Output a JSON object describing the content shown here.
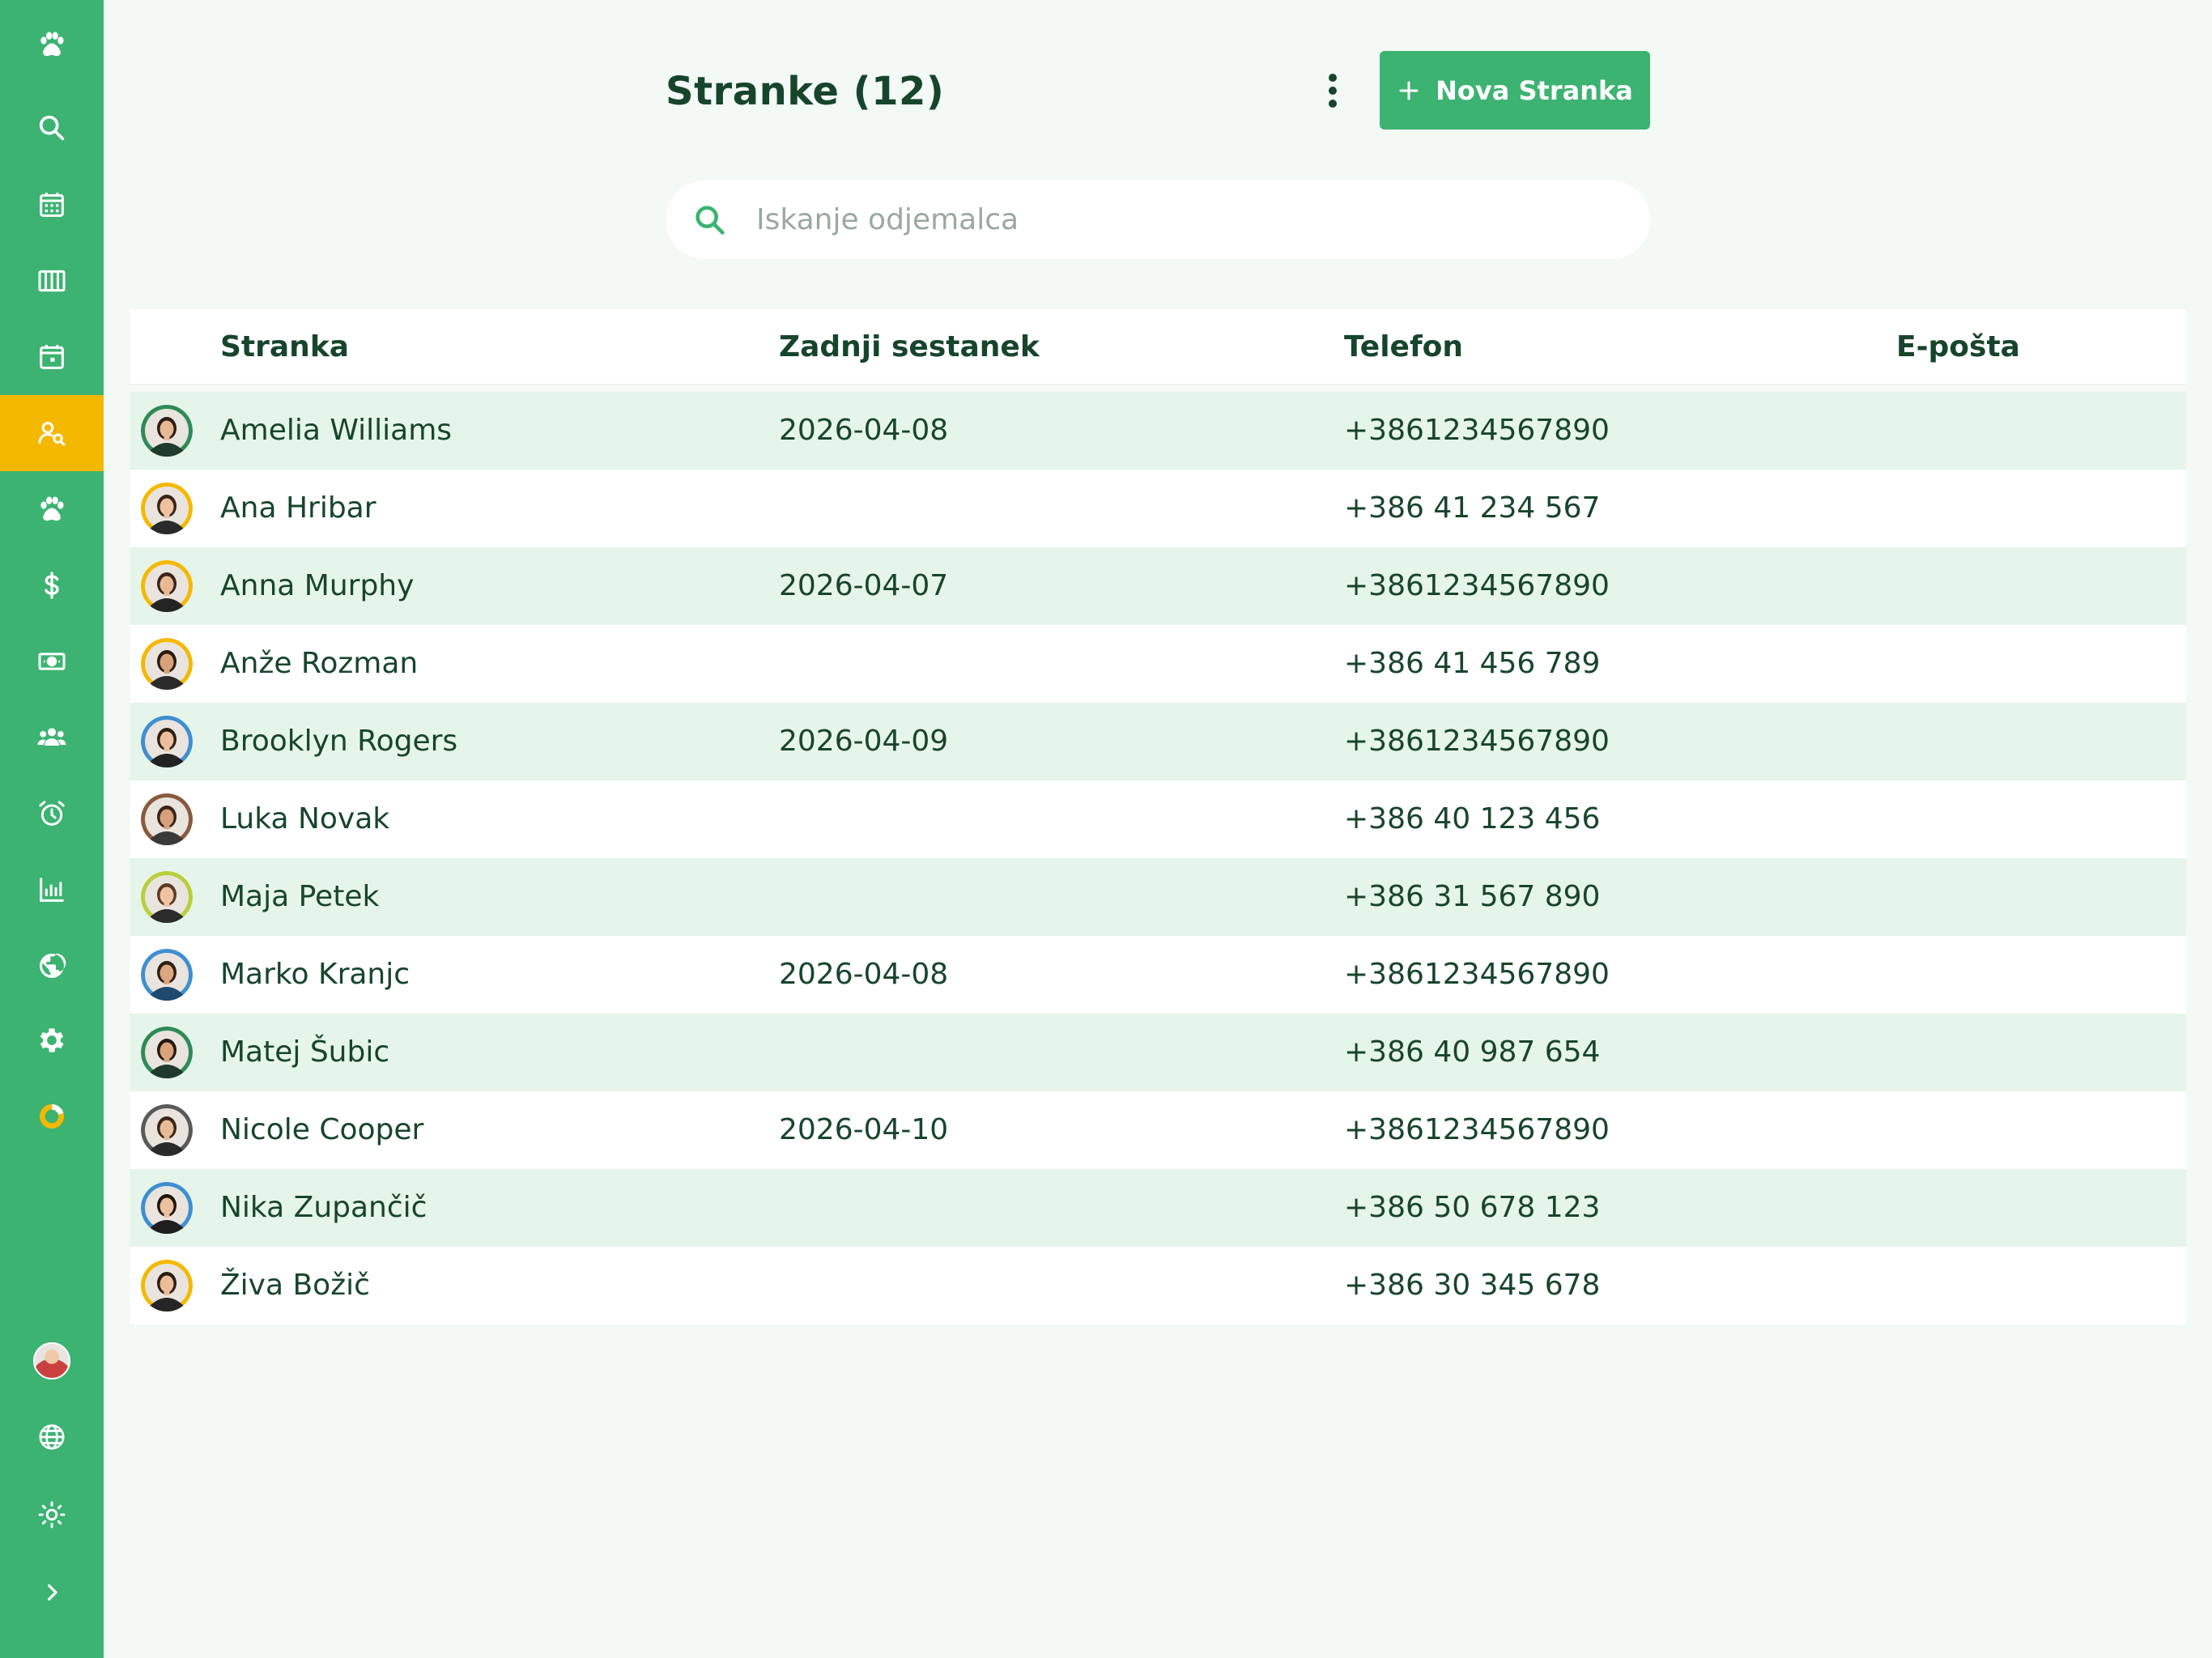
{
  "sidebar": {
    "items": [
      {
        "icon": "paw-icon",
        "name": "nav-home"
      },
      {
        "icon": "search-icon",
        "name": "nav-search"
      },
      {
        "icon": "calendar-icon",
        "name": "nav-calendar"
      },
      {
        "icon": "columns-icon",
        "name": "nav-board"
      },
      {
        "icon": "calendar-day-icon",
        "name": "nav-schedule"
      },
      {
        "icon": "client-search-icon",
        "name": "nav-clients",
        "active": true
      },
      {
        "icon": "paw-icon",
        "name": "nav-pets"
      },
      {
        "icon": "dollar-icon",
        "name": "nav-payments"
      },
      {
        "icon": "banknote-icon",
        "name": "nav-cash"
      },
      {
        "icon": "users-icon",
        "name": "nav-team"
      },
      {
        "icon": "alarm-icon",
        "name": "nav-reminders"
      },
      {
        "icon": "chart-icon",
        "name": "nav-reports"
      },
      {
        "icon": "globe-icon",
        "name": "nav-web"
      },
      {
        "icon": "gear-icon",
        "name": "nav-settings"
      },
      {
        "icon": "donut-icon",
        "name": "nav-usage"
      }
    ],
    "bottom": [
      {
        "icon": "user-avatar",
        "name": "nav-profile"
      },
      {
        "icon": "language-icon",
        "name": "nav-language"
      },
      {
        "icon": "sun-icon",
        "name": "nav-theme"
      },
      {
        "icon": "chevron-right-icon",
        "name": "nav-expand"
      }
    ],
    "colors": {
      "background": "#3cb371",
      "active": "#f5b800"
    }
  },
  "header": {
    "title": "Stranke (12)",
    "new_button_label": "Nova Stranka"
  },
  "search": {
    "placeholder": "Iskanje odjemalca",
    "value": ""
  },
  "table": {
    "columns": [
      "Stranka",
      "Zadnji sestanek",
      "Telefon",
      "E-pošta"
    ],
    "rows": [
      {
        "name": "Amelia Williams",
        "last_meeting": "2026-04-08",
        "phone": "+3861234567890",
        "email": "",
        "ring": "#2e8b57",
        "skin": "#e8b894",
        "hair": "#2b1d14",
        "shirt": "#1f3b2c"
      },
      {
        "name": "Ana Hribar",
        "last_meeting": "",
        "phone": "+386 41 234 567",
        "email": "",
        "ring": "#f5b800",
        "skin": "#eec1a0",
        "hair": "#3a2416",
        "shirt": "#2a2a2a"
      },
      {
        "name": "Anna Murphy",
        "last_meeting": "2026-04-07",
        "phone": "+3861234567890",
        "email": "",
        "ring": "#f5b800",
        "skin": "#e9b996",
        "hair": "#3b2518",
        "shirt": "#242424"
      },
      {
        "name": "Anže Rozman",
        "last_meeting": "",
        "phone": "+386 41 456 789",
        "email": "",
        "ring": "#f5b800",
        "skin": "#d9a27a",
        "hair": "#2a1a10",
        "shirt": "#2b2b2b"
      },
      {
        "name": "Brooklyn Rogers",
        "last_meeting": "2026-04-09",
        "phone": "+3861234567890",
        "email": "",
        "ring": "#3f8fd0",
        "skin": "#ebbf9e",
        "hair": "#2e1e14",
        "shirt": "#222"
      },
      {
        "name": "Luka Novak",
        "last_meeting": "",
        "phone": "+386 40 123 456",
        "email": "",
        "ring": "#8a5a3c",
        "skin": "#d8a07c",
        "hair": "#3b2417",
        "shirt": "#3a3a3a"
      },
      {
        "name": "Maja Petek",
        "last_meeting": "",
        "phone": "+386 31 567 890",
        "email": "",
        "ring": "#b8cf3a",
        "skin": "#efc4a4",
        "hair": "#5a3a22",
        "shirt": "#2c2c2c"
      },
      {
        "name": "Marko Kranjc",
        "last_meeting": "2026-04-08",
        "phone": "+3861234567890",
        "email": "",
        "ring": "#3f8fd0",
        "skin": "#dca780",
        "hair": "#2f1f14",
        "shirt": "#1f4a6e"
      },
      {
        "name": "Matej Šubic",
        "last_meeting": "",
        "phone": "+386 40 987 654",
        "email": "",
        "ring": "#2e8b57",
        "skin": "#d9a47c",
        "hair": "#26170e",
        "shirt": "#1f3b2c"
      },
      {
        "name": "Nicole Cooper",
        "last_meeting": "2026-04-10",
        "phone": "+3861234567890",
        "email": "",
        "ring": "#5a5a5a",
        "skin": "#e8bb98",
        "hair": "#3a2619",
        "shirt": "#2a2a2a"
      },
      {
        "name": "Nika Zupančič",
        "last_meeting": "",
        "phone": "+386 50 678 123",
        "email": "",
        "ring": "#3f8fd0",
        "skin": "#eac0a0",
        "hair": "#1f140c",
        "shirt": "#1e1e1e"
      },
      {
        "name": "Živa Božič",
        "last_meeting": "",
        "phone": "+386 30 345 678",
        "email": "",
        "ring": "#f5b800",
        "skin": "#e9bc9a",
        "hair": "#2d1c12",
        "shirt": "#262626"
      }
    ]
  },
  "colors": {
    "page_bg": "#f3f9f5",
    "text": "#17452c",
    "accent": "#3cb371",
    "row_alt": "#e6f5ea"
  }
}
